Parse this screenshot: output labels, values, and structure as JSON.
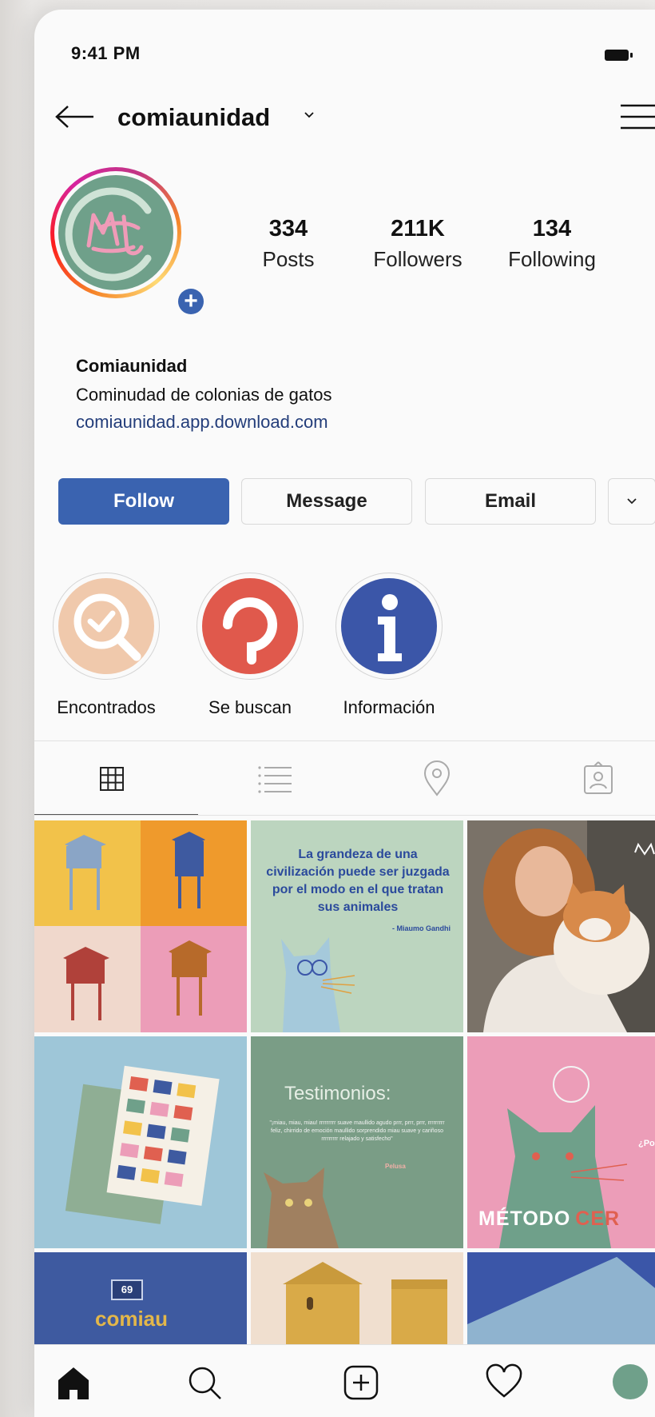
{
  "status_bar": {
    "time": "9:41 PM"
  },
  "header": {
    "username": "comiaunidad"
  },
  "profile": {
    "stats": [
      {
        "value": "334",
        "label": "Posts"
      },
      {
        "value": "211K",
        "label": "Followers"
      },
      {
        "value": "134",
        "label": "Following"
      }
    ],
    "name": "Comiaunidad",
    "bio": "Cominudad de colonias de gatos",
    "link": "comiaunidad.app.download.com"
  },
  "actions": {
    "follow": "Follow",
    "message": "Message",
    "email": "Email"
  },
  "highlights": [
    {
      "label": "Encontrados",
      "color": "#f0c9ac"
    },
    {
      "label": "Se buscan",
      "color": "#e0594c"
    },
    {
      "label": "Información",
      "color": "#3b56a8"
    }
  ],
  "posts": {
    "quote": {
      "text": "La grandeza de una civilización puede ser juzgada por el modo en el que tratan sus animales",
      "author": "- Miaumo Gandhi"
    },
    "testimonios": {
      "title": "Testimonios:",
      "body": "\"¡miau, miau, miau! rrrrrrrrr suave maullido agudo prrr, prrr, prrr, rrrrrrrrr feliz, chirrido de emoción maullido sorprendido miau suave y cariñoso rrrrrrrrr relajado y satisfecho\"",
      "author": "Pelusa"
    },
    "metodo": {
      "word1": "MÉTODO",
      "word2": "CER",
      "side": "¿Por qué"
    },
    "door_number": "69",
    "door_sign": "comiau"
  },
  "colors": {
    "accent": "#3a63b0",
    "brand_green": "#6fa08a"
  }
}
